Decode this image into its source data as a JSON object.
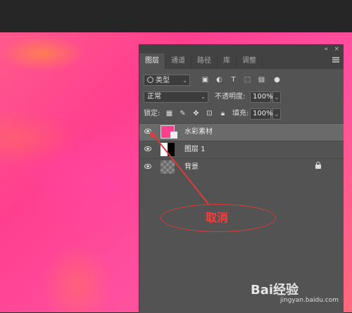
{
  "panel": {
    "tabs": [
      {
        "label": "图层",
        "active": true
      },
      {
        "label": "通道",
        "active": false
      },
      {
        "label": "路径",
        "active": false
      },
      {
        "label": "库",
        "active": false
      },
      {
        "label": "调整",
        "active": false
      }
    ],
    "header_collapse": "«",
    "header_close": "×"
  },
  "filter": {
    "label": "类型"
  },
  "blend": {
    "mode": "正常",
    "opacity_label": "不透明度:",
    "opacity_value": "100%"
  },
  "lock": {
    "label": "锁定:",
    "fill_label": "填充:",
    "fill_value": "100%"
  },
  "layers": [
    {
      "name": "水彩素材",
      "selected": true,
      "visible": true,
      "locked": false
    },
    {
      "name": "图层 1",
      "selected": false,
      "visible": true,
      "locked": false
    },
    {
      "name": "背景",
      "selected": false,
      "visible": true,
      "locked": true
    }
  ],
  "annotation": {
    "text": "取消",
    "color": "#e03a3a"
  },
  "watermark": {
    "text": "Bai经验",
    "url": "jingyan.baidu.com"
  },
  "colors": {
    "panel_bg": "#535353",
    "selected_row": "#6a6a6a",
    "canvas_pink": "#ff4f9a"
  }
}
